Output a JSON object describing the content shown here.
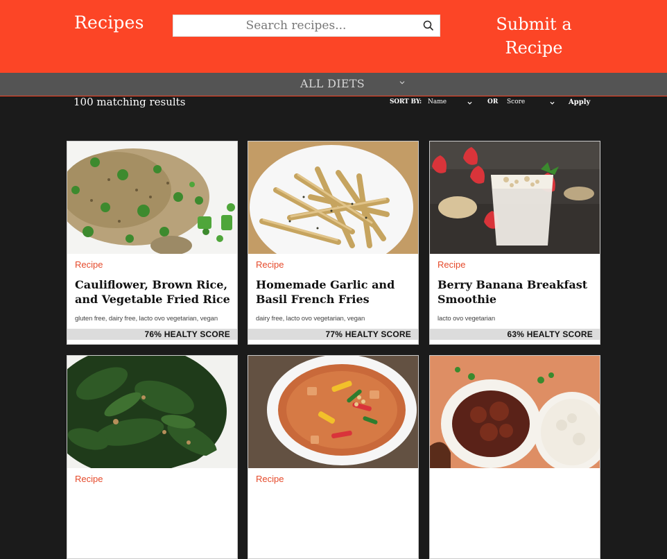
{
  "header": {
    "brand": "Recipes",
    "search_placeholder": "Search recipes...",
    "submit_line1": "Submit a",
    "submit_line2": "Recipe",
    "color": "#fc4526"
  },
  "diet_filter": {
    "selected": "ALL DIETS"
  },
  "results": {
    "count_text": "100 matching results"
  },
  "sort": {
    "label": "SORT BY:",
    "primary": "Name",
    "or_label": "OR",
    "secondary": "Score",
    "apply": "Apply"
  },
  "cards": [
    {
      "kind": "Recipe",
      "title": "Cauliflower, Brown Rice, and Vegetable Fried Rice",
      "diets": "gluten free, dairy free, lacto ovo vegetarian, vegan",
      "score": "76% HEALTY SCORE"
    },
    {
      "kind": "Recipe",
      "title": "Homemade Garlic and Basil French Fries",
      "diets": "dairy free, lacto ovo vegetarian, vegan",
      "score": "77% HEALTY SCORE"
    },
    {
      "kind": "Recipe",
      "title": "Berry Banana Breakfast Smoothie",
      "diets": "lacto ovo vegetarian",
      "score": "63% HEALTY SCORE"
    },
    {
      "kind": "Recipe",
      "title": "",
      "diets": "",
      "score": ""
    },
    {
      "kind": "Recipe",
      "title": "",
      "diets": "",
      "score": ""
    },
    {
      "kind": "",
      "title": "",
      "diets": "",
      "score": ""
    }
  ]
}
